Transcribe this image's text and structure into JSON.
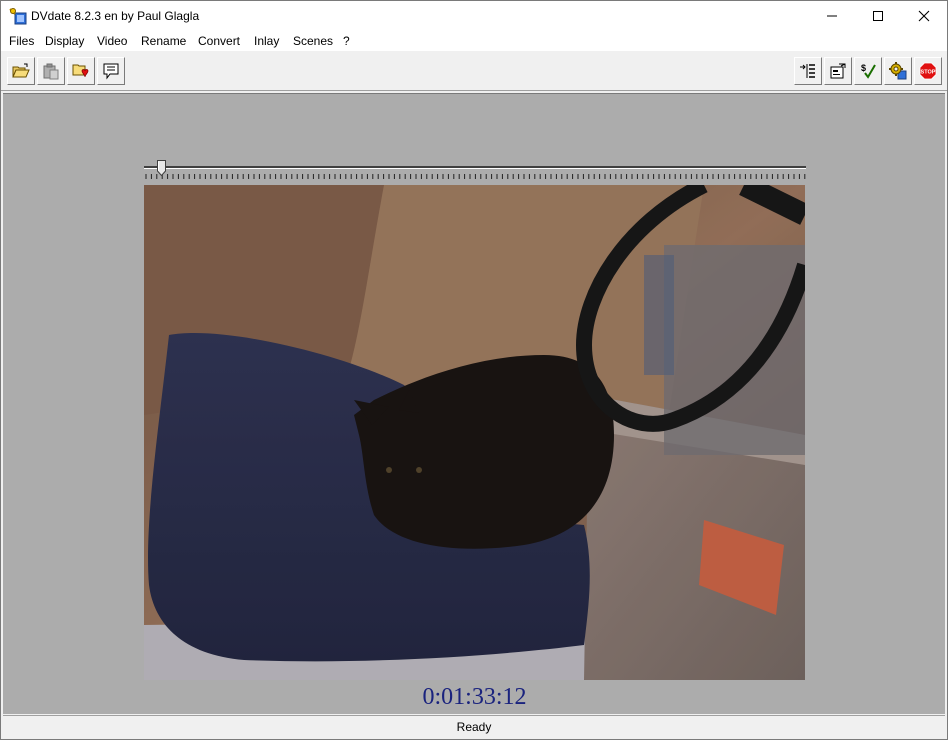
{
  "window": {
    "title": "DVdate 8.2.3 en by Paul Glagla",
    "app_icon": "dvdate-app-icon"
  },
  "menu": {
    "items": [
      "Files",
      "Display",
      "Video",
      "Rename",
      "Convert",
      "Inlay",
      "Scenes",
      "?"
    ]
  },
  "toolbar": {
    "left_buttons": [
      "open-folder-icon",
      "paste-clipboard-icon",
      "favorite-folder-icon",
      "comment-icon"
    ],
    "right_buttons": [
      "insert-list-icon",
      "properties-icon",
      "check-icon",
      "settings-gear-icon",
      "stop-icon"
    ],
    "stop_label": "STOP"
  },
  "player": {
    "slider_position": 0.02,
    "timecode": "0:01:33:12",
    "timecode_color": "#1a237e"
  },
  "status": {
    "text": "Ready"
  },
  "colors": {
    "content_background": "#acacac",
    "chrome": "#f0f0f0"
  }
}
